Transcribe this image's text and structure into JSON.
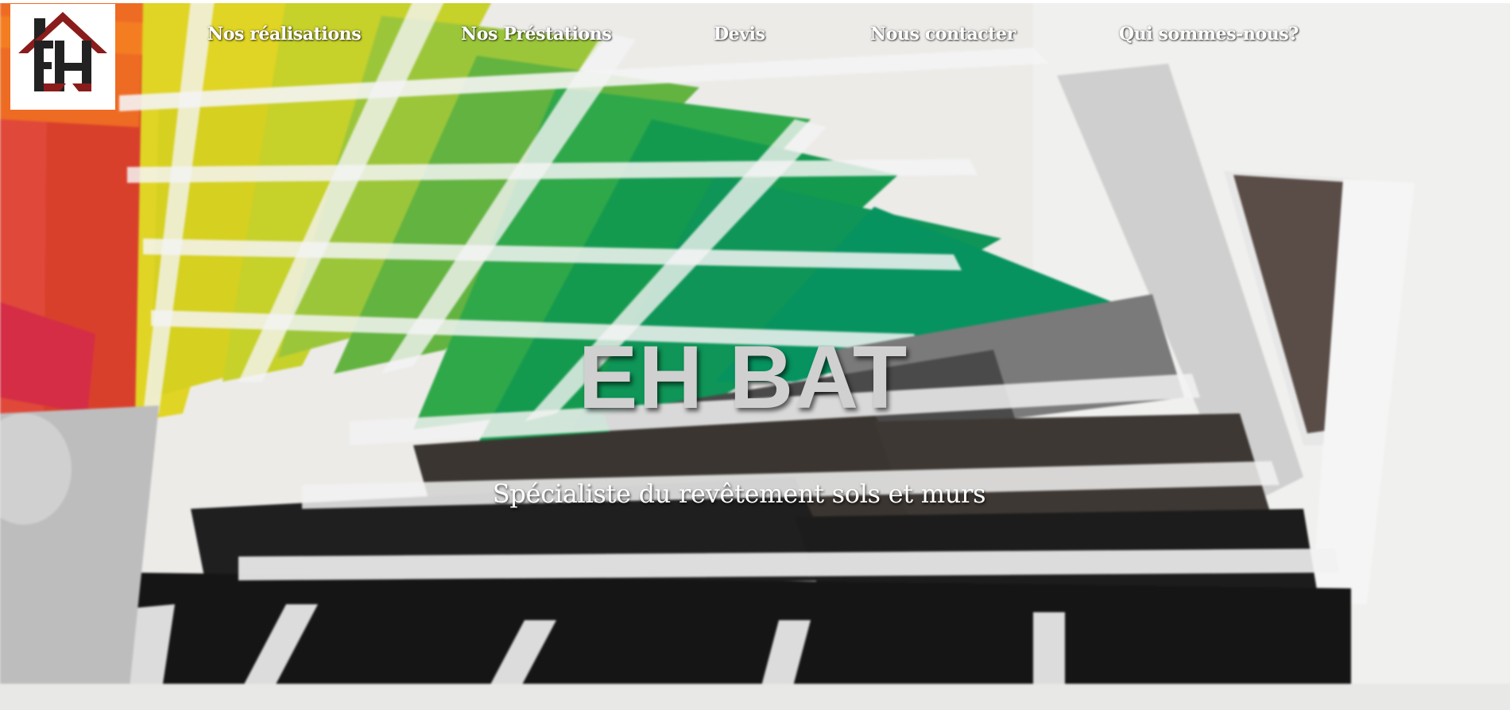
{
  "site": {
    "logo_letters": "EH"
  },
  "nav": {
    "items": [
      {
        "label": "Nos réalisations"
      },
      {
        "label": "Nos Préstations"
      },
      {
        "label": "Devis"
      },
      {
        "label": "Nous contacter"
      },
      {
        "label": "Qui sommes-nous?"
      }
    ]
  },
  "hero": {
    "title": "EH BAT",
    "subtitle": "Spécialiste du revêtement sols et murs"
  },
  "colors": {
    "logo_red": "#8a1c1c",
    "logo_dark": "#222222",
    "nav_text": "#ffffff",
    "title_text": "#d0d0d0"
  }
}
